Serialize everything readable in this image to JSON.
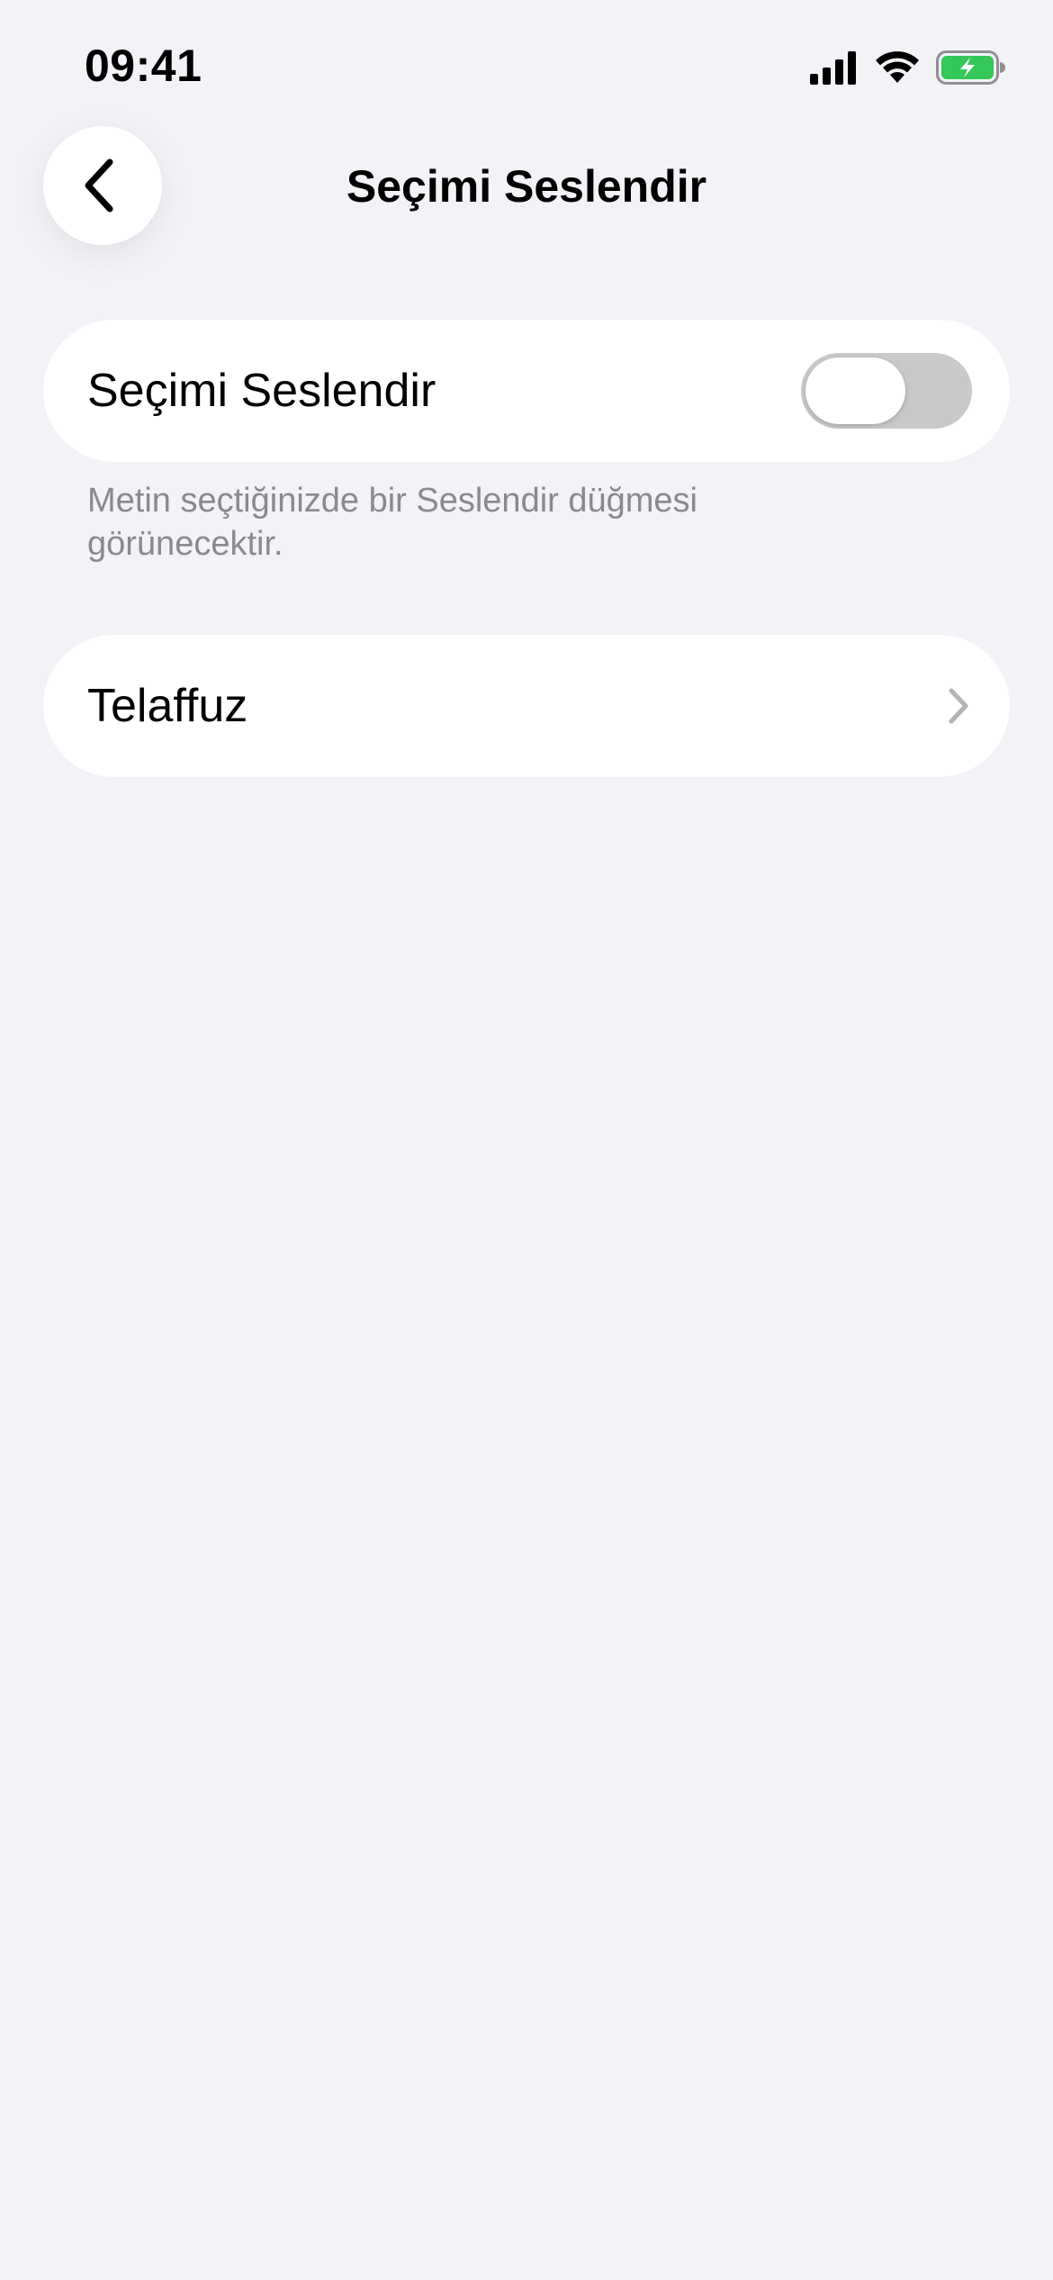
{
  "status_bar": {
    "time": "09:41",
    "icons": [
      "cellular-signal-icon",
      "wifi-icon",
      "battery-charging-icon"
    ],
    "battery_color": "#34c759"
  },
  "nav": {
    "back_icon": "chevron-left-icon",
    "title": "Seçimi Seslendir"
  },
  "settings": {
    "speak_selection": {
      "label": "Seçimi Seslendir",
      "toggle_on": false,
      "footnote": "Metin seçtiğinizde bir Seslendir düğmesi görünecektir."
    },
    "pronunciation": {
      "label": "Telaffuz",
      "icon": "chevron-right-icon"
    }
  },
  "colors": {
    "background": "#f2f2f7",
    "card": "#ffffff",
    "secondary_text": "#8a8a8e",
    "toggle_off": "#c9c9cb"
  }
}
